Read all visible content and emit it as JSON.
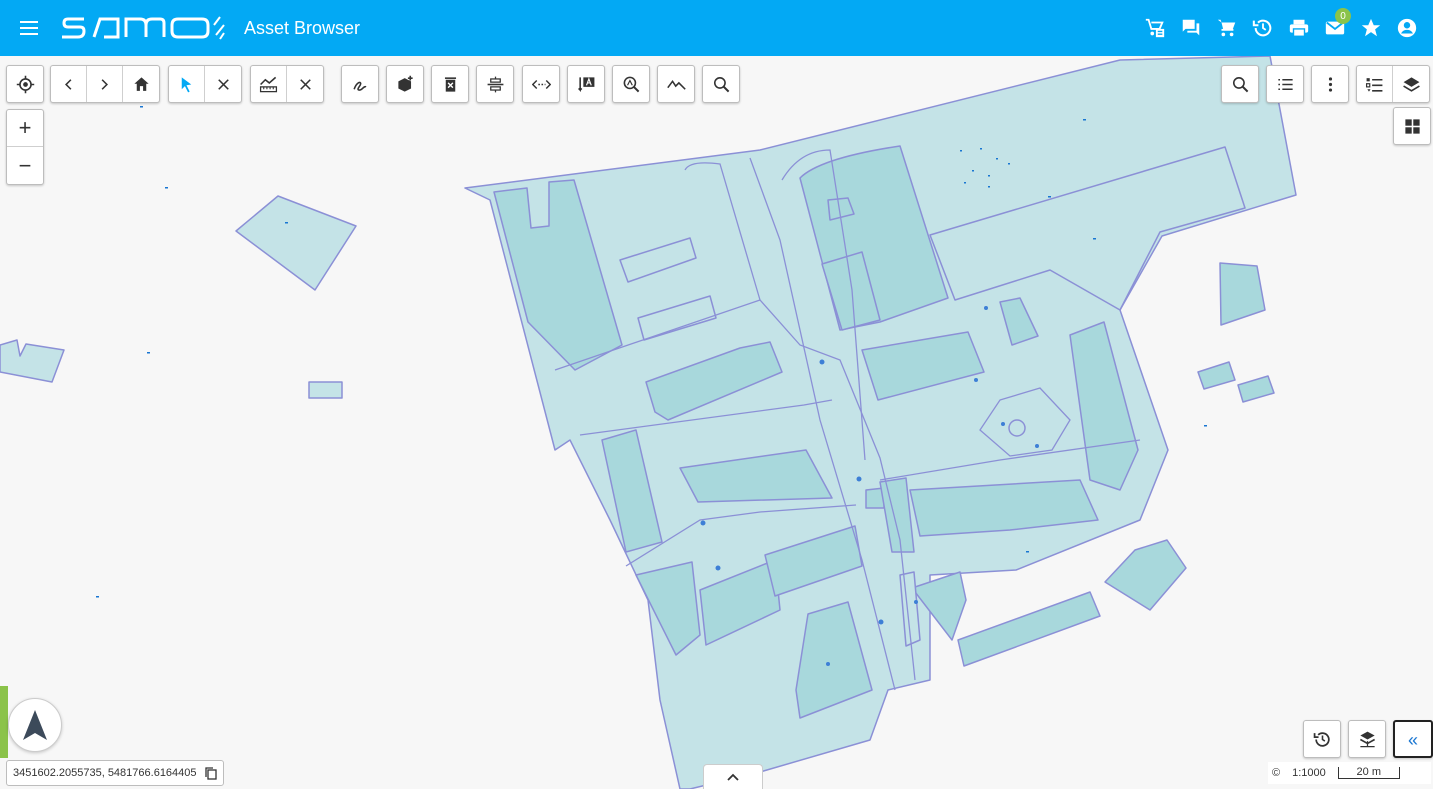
{
  "header": {
    "app_title": "Asset Browser",
    "mail_badge": "0",
    "brand_color": "#03a9f4"
  },
  "toolbar": {
    "left_icons": [
      "locate-icon",
      "back-icon",
      "forward-icon",
      "home-icon",
      "select-icon",
      "clear-selection-icon",
      "measure-icon",
      "clear-measure-icon",
      "draw-icon",
      "add-asset-icon",
      "delete-icon",
      "split-icon",
      "distance-icon",
      "label-icon",
      "zoom-search-icon",
      "profile-icon",
      "search-icon"
    ],
    "right_icons": [
      "search-icon",
      "list-icon",
      "more-icon",
      "legend-icon",
      "layers-icon",
      "grid-icon"
    ]
  },
  "zoom": {
    "in_label": "+",
    "out_label": "−"
  },
  "status": {
    "coordinates": "3451602.2055735, 5481766.6164405",
    "copyright": "©",
    "scale_ratio": "1:1000",
    "scale_bar": "20 m"
  },
  "map": {
    "fill_color": "#c4e3e7",
    "building_color": "#a8d8dc",
    "stroke_color": "#8b90d6"
  }
}
